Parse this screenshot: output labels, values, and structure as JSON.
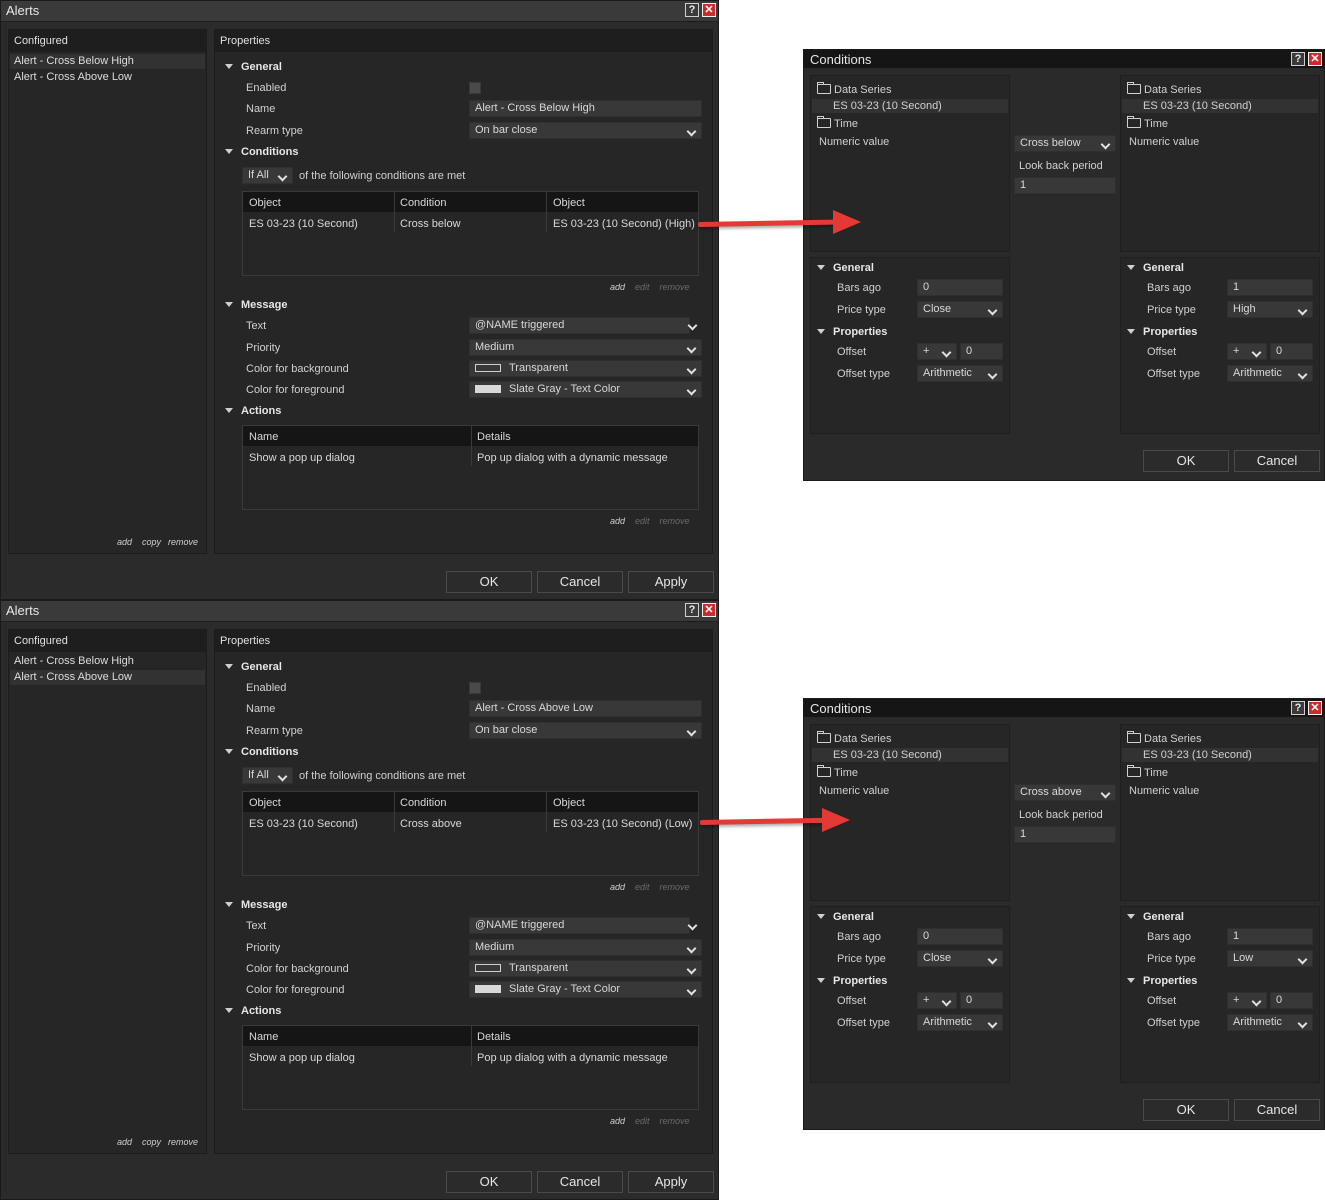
{
  "common": {
    "window_title": "Alerts",
    "help_glyph": "?",
    "close_glyph": "✕",
    "configured_header": "Configured",
    "properties_header": "Properties",
    "sections": {
      "general": "General",
      "conditions": "Conditions",
      "message": "Message",
      "actions": "Actions"
    },
    "labels": {
      "enabled": "Enabled",
      "name": "Name",
      "rearm_type": "Rearm type",
      "text": "Text",
      "priority": "Priority",
      "color_background": "Color for background",
      "color_foreground": "Color for foreground"
    },
    "rearm_value": "On bar close",
    "if_value": "If All",
    "if_suffix": "of the following conditions are met",
    "cond_columns": [
      "Object",
      "Condition",
      "Object"
    ],
    "message_text": "@NAME triggered",
    "priority_value": "Medium",
    "bg_value": "Transparent",
    "fg_value": "Slate Gray - Text Color",
    "action_columns": [
      "Name",
      "Details"
    ],
    "action_row": [
      "Show a pop up dialog",
      "Pop up dialog with a dynamic message"
    ],
    "link_add": "add",
    "link_edit": "edit",
    "link_remove": "remove",
    "link_copy": "copy",
    "ok": "OK",
    "cancel": "Cancel",
    "apply": "Apply",
    "configured_items": [
      "Alert - Cross Below High",
      "Alert - Cross Above Low"
    ],
    "conditions_title": "Conditions",
    "data_series": "Data Series",
    "series_name": "ES 03-23 (10 Second)",
    "time": "Time",
    "numeric_value": "Numeric value",
    "look_back_period": "Look back period",
    "look_back_value": "1",
    "bars_ago": "Bars ago",
    "price_type": "Price type",
    "properties": "Properties",
    "offset": "Offset",
    "offset_type": "Offset type",
    "offset_sign": "+",
    "offset_value": "0",
    "offset_type_value": "Arithmetic",
    "left_bars_ago": "0",
    "left_price_type": "Close",
    "right_bars_ago": "1"
  },
  "top": {
    "alert_name": "Alert - Cross Below High",
    "cond_row": [
      "ES 03-23 (10 Second)",
      "Cross below",
      "ES 03-23 (10 Second) (High)"
    ],
    "cond_operator": "Cross below",
    "right_price_type": "High"
  },
  "bottom": {
    "alert_name": "Alert - Cross Above Low",
    "cond_row": [
      "ES 03-23 (10 Second)",
      "Cross above",
      "ES 03-23 (10 Second) (Low)"
    ],
    "cond_operator": "Cross above",
    "right_price_type": "Low"
  },
  "colors": {
    "arrow": "#e53935",
    "close_button": "#cc2b2b",
    "background": "#2b2b2b"
  }
}
